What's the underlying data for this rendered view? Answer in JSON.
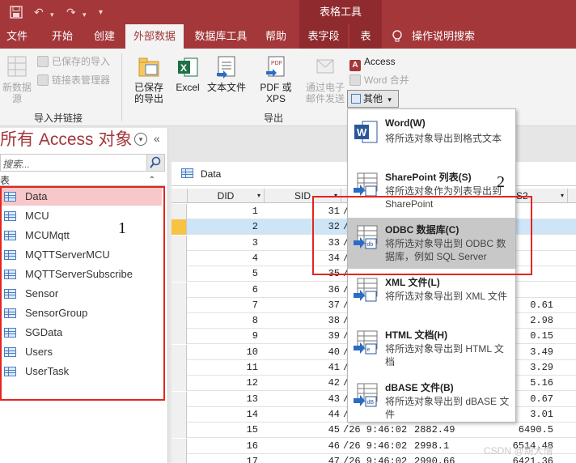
{
  "title_bar": {
    "context_title": "表格工具",
    "qat_icons": [
      "save-icon",
      "undo-icon",
      "redo-icon",
      "customize-icon"
    ]
  },
  "tabs": [
    "文件",
    "开始",
    "创建",
    "外部数据",
    "数据库工具",
    "帮助",
    "表字段",
    "表",
    "操作说明搜索"
  ],
  "ribbon": {
    "import_group": {
      "new_source": "新数据源",
      "saved_imports": "已保存的导入",
      "linked_table_manager": "链接表管理器",
      "label": "导入并链接"
    },
    "export_group": {
      "saved_exports": "已保存的导出",
      "excel": "Excel",
      "text_file": "文本文件",
      "pdf_xps": "PDF 或 XPS",
      "email": "通过电子邮件发送",
      "access": "Access",
      "word_merge": "Word 合并",
      "other": "其他",
      "label": "导出"
    }
  },
  "nav_pane": {
    "title": "所有 Access 对象",
    "search_placeholder": "搜索...",
    "section": "表",
    "items": [
      "Data",
      "MCU",
      "MCUMqtt",
      "MQTTServerMCU",
      "MQTTServerSubscribe",
      "Sensor",
      "SensorGroup",
      "SGData",
      "Users",
      "UserTask"
    ],
    "selected": "Data"
  },
  "datasheet": {
    "tab_label": "Data",
    "headers": [
      "DID",
      "SID",
      "S2"
    ],
    "rows": [
      [
        "1",
        "31",
        "/",
        "",
        ""
      ],
      [
        "2",
        "32",
        "/",
        "",
        ""
      ],
      [
        "3",
        "33",
        "/",
        "",
        ""
      ],
      [
        "4",
        "34",
        "/",
        "",
        ""
      ],
      [
        "5",
        "35",
        "/",
        "",
        ""
      ],
      [
        "6",
        "36",
        "/",
        "",
        ""
      ],
      [
        "7",
        "37",
        "/",
        "",
        "0.61"
      ],
      [
        "8",
        "38",
        "/",
        "",
        "2.98"
      ],
      [
        "9",
        "39",
        "/",
        "",
        "0.15"
      ],
      [
        "10",
        "40",
        "/",
        "",
        "3.49"
      ],
      [
        "11",
        "41",
        "/",
        "",
        "3.29"
      ],
      [
        "12",
        "42",
        "/",
        "",
        "5.16"
      ],
      [
        "13",
        "43",
        "/",
        "",
        "0.67"
      ],
      [
        "14",
        "44",
        "/",
        "",
        "3.01"
      ],
      [
        "15",
        "45",
        "/26 9:46:02",
        "2882.49",
        "6490.5"
      ],
      [
        "16",
        "46",
        "/26 9:46:02",
        "2998.1",
        "6514.48"
      ],
      [
        "17",
        "47",
        "/26 9:46:02",
        "2990.66",
        "6421.36"
      ]
    ],
    "current_row": 1
  },
  "dropdown": [
    {
      "title": "Word(W)",
      "desc": "将所选对象导出到格式文本"
    },
    {
      "title": "SharePoint 列表(S)",
      "desc": "将所选对象作为列表导出到 SharePoint"
    },
    {
      "title": "ODBC 数据库(C)",
      "desc": "将所选对象导出到 ODBC 数据库，例如 SQL Server"
    },
    {
      "title": "XML 文件(L)",
      "desc": "将所选对象导出到 XML 文件"
    },
    {
      "title": "HTML 文档(H)",
      "desc": "将所选对象导出到 HTML 文档"
    },
    {
      "title": "dBASE 文件(B)",
      "desc": "将所选对象导出到 dBASE 文件"
    }
  ],
  "annotations": {
    "box1": "1",
    "box2": "2"
  },
  "watermark": "CSDN @葫大憎"
}
